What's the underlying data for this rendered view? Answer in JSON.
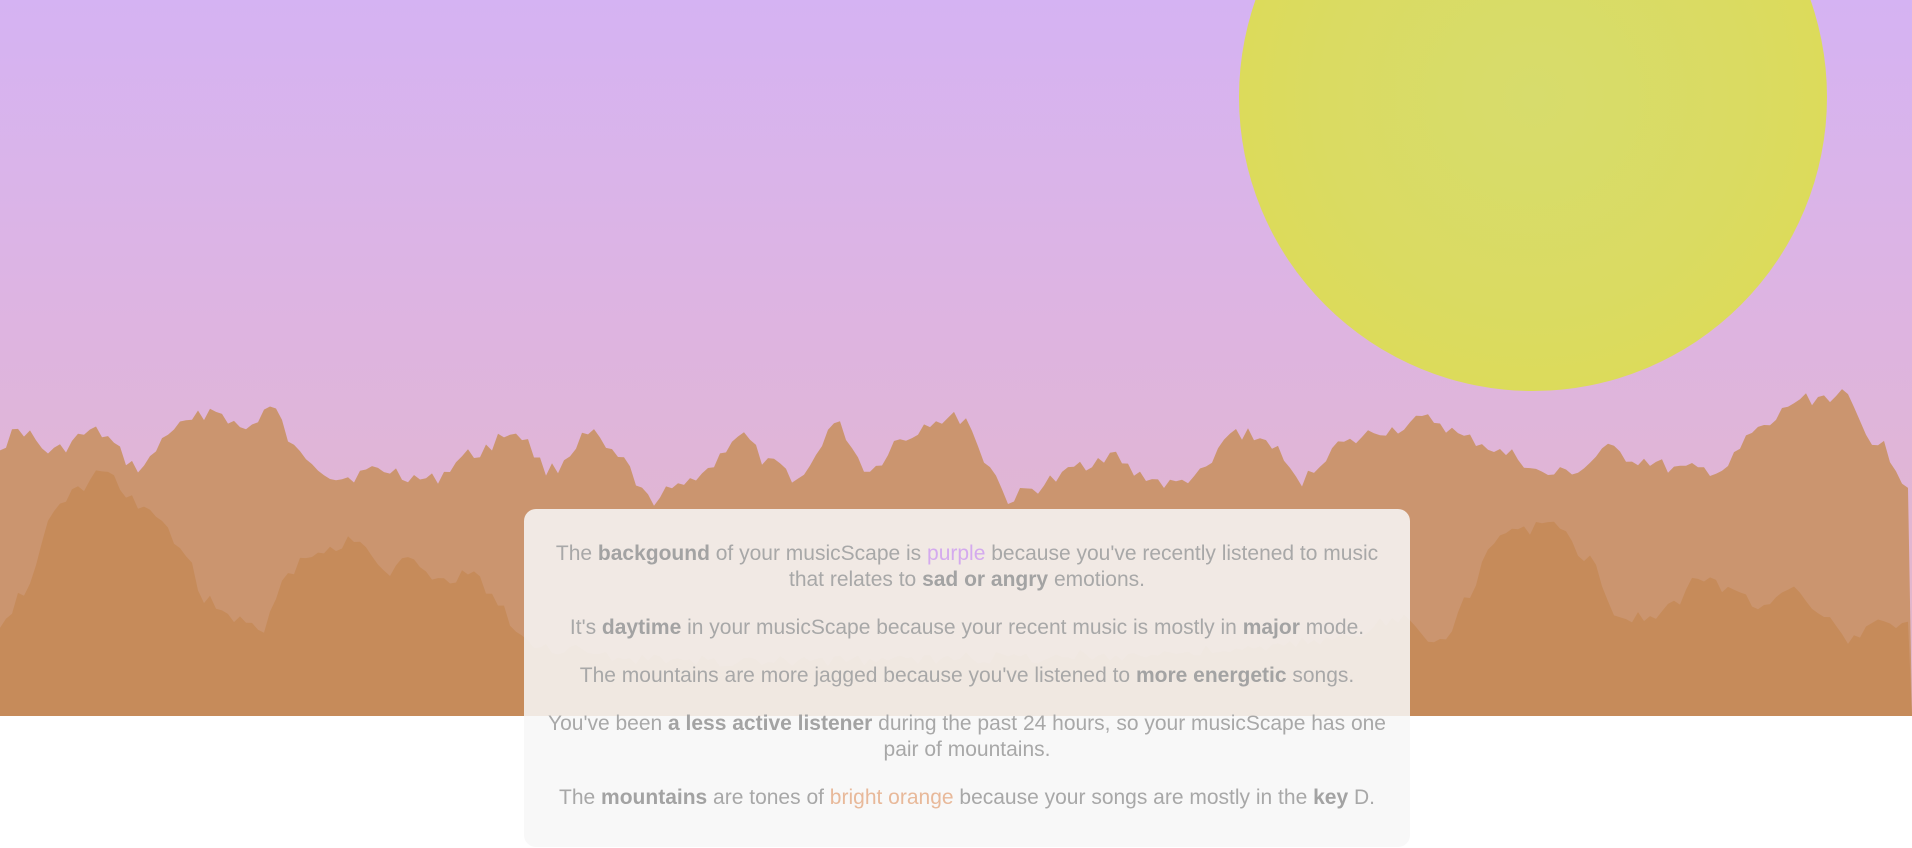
{
  "colors": {
    "sky_top": "#d5b3f3",
    "sky_bottom": "#e4b7c6",
    "sun": "#dadb62",
    "mountain_back": "#cb956f",
    "mountain_front": "#c68b5a",
    "card_background": "#f7f7f7",
    "text": "#a8a8a8",
    "purple_accent": "#d4aaee",
    "orange_accent": "#e8b99a"
  },
  "icons": [
    "sun-shape",
    "mountain-range-back",
    "mountain-range-front"
  ],
  "description": {
    "p1": {
      "t1": "The ",
      "b1": "backgound",
      "t2": " of your musicScape is ",
      "color_word": "purple",
      "t3": " because you've recently listened to music that relates to ",
      "b2": "sad or angry",
      "t4": " emotions."
    },
    "p2": {
      "t1": "It's ",
      "b1": "daytime",
      "t2": " in your musicScape because your recent music is mostly in ",
      "b2": "major",
      "t3": " mode."
    },
    "p3": {
      "t1": "The mountains are more jagged because you've listened to ",
      "b1": "more energetic",
      "t2": " songs."
    },
    "p4": {
      "t1": "You've been ",
      "b1": "a less active listener",
      "t2": " during the past 24 hours, so your musicScape has one pair of mountains."
    },
    "p5": {
      "t1": "The ",
      "b1": "mountains",
      "t2": " are tones of ",
      "color_word": "bright orange",
      "t3": " because your songs are mostly in the ",
      "b2": "key",
      "t4": " D."
    }
  }
}
